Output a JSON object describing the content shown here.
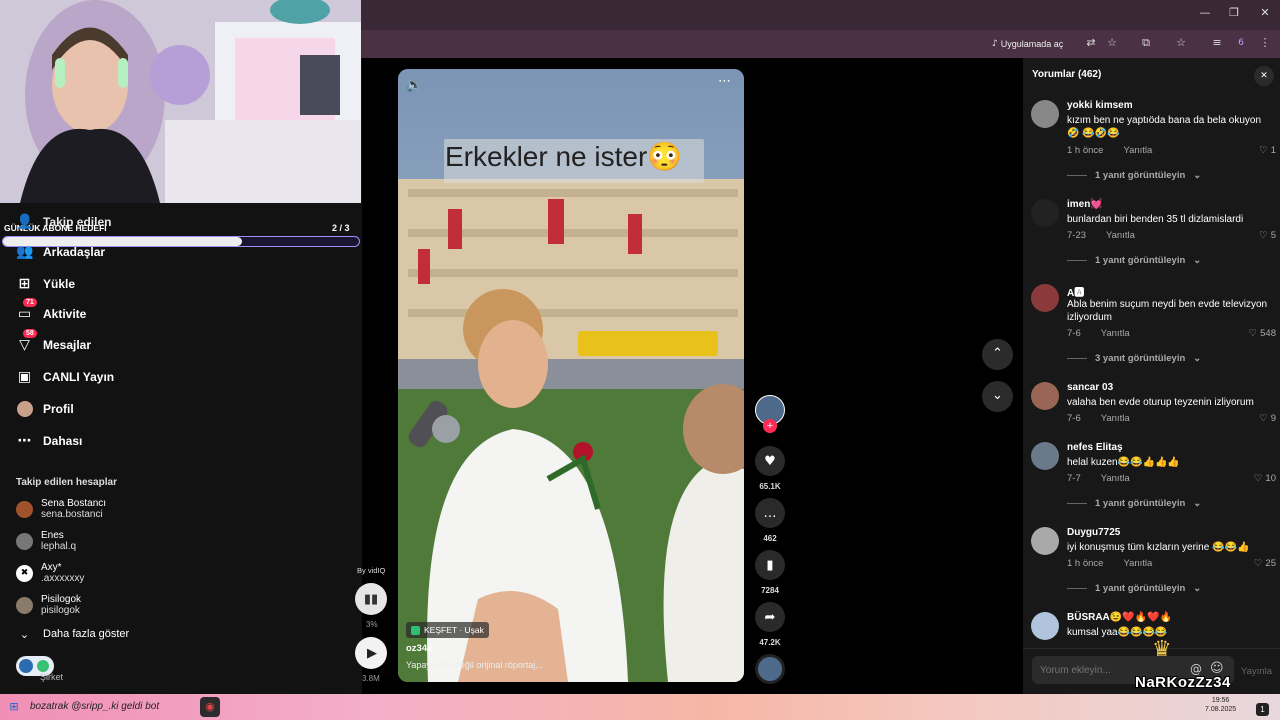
{
  "browser": {
    "window_controls": {
      "minimize": "—",
      "restore": "❐",
      "close": "✕"
    },
    "open_in_app_label": "Uygulamada aç",
    "profile_badge": "6"
  },
  "overlay": {
    "goal_label": "GÜNLÜK ABONE HEDEFİ",
    "goal_count": "2 / 3",
    "goal_progress": 0.67,
    "bottom_name": "NaRKozZz34"
  },
  "nav": {
    "following": "Takip edilen",
    "friends": "Arkadaşlar",
    "upload": "Yükle",
    "activity": "Aktivite",
    "activity_badge": "71",
    "messages": "Mesajlar",
    "messages_badge": "58",
    "live": "CANLI Yayın",
    "profile": "Profil",
    "more": "Dahası"
  },
  "following_section": {
    "title": "Takip edilen hesaplar",
    "accounts": [
      {
        "name": "Sena Bostancı",
        "handle": "sena.bostanci",
        "color": "#a0522d"
      },
      {
        "name": "Enes",
        "handle": "lephal.q",
        "color": "#777777"
      },
      {
        "name": "Axy*",
        "handle": ".axxxxxxy",
        "color": "#ffffff"
      },
      {
        "name": "Pisilogok",
        "handle": "pisilogok",
        "color": "#8a7a6a"
      }
    ],
    "show_more": "Daha fazla göster",
    "company": "Şirket"
  },
  "vidiq": {
    "by": "By vidIQ",
    "percent": "3%",
    "views": "3.8M"
  },
  "video": {
    "caption_overlay": "Erkekler ne ister😳",
    "location": "KEŞFET · Uşak",
    "author": "oz34x",
    "description": "Yapay zeka değil orijinal röportaj..."
  },
  "actions": {
    "likes": "65.1K",
    "comments": "462",
    "saves": "7284",
    "shares": "47.2K"
  },
  "comments_panel": {
    "title": "Yorumlar (462)",
    "input_placeholder": "Yorum ekleyin...",
    "post_label": "Yayınla",
    "reply_label": "Yanıtla",
    "items": [
      {
        "user": "yokki kimsem",
        "text": "kızım ben ne yaptıöda bana da bela okuyon 🤣 😂🤣😂",
        "time": "1 h önce",
        "likes": "1",
        "replies": "1 yanıt görüntüleyin",
        "color": "#888888"
      },
      {
        "user": "imen💓",
        "text": "bunlardan biri benden 35 tl dizlamislardi",
        "time": "7-23",
        "likes": "5",
        "replies": "1 yanıt görüntüleyin",
        "color": "#222222"
      },
      {
        "user": "A🅰",
        "text": "Abla benim suçum neydi ben evde televizyon izliyordum",
        "time": "7-6",
        "likes": "548",
        "replies": "3 yanıt görüntüleyin",
        "color": "#8a3a3a"
      },
      {
        "user": "sancar 03",
        "text": "valaha ben evde oturup teyzenin izliyorum",
        "time": "7-6",
        "likes": "9",
        "replies": "",
        "color": "#996655"
      },
      {
        "user": "nefes Elitaş",
        "text": "helal kuzen😂😂👍👍👍",
        "time": "7-7",
        "likes": "10",
        "replies": "1 yanıt görüntüleyin",
        "color": "#6a7a8a"
      },
      {
        "user": "Duygu7725",
        "text": "iyi konuşmuş tüm kızların yerine 😂😂👍",
        "time": "1 h önce",
        "likes": "25",
        "replies": "1 yanıt görüntüleyin",
        "color": "#a9a9a9"
      },
      {
        "user": "BÜSRAA😉❤️🔥❤️🔥",
        "text": "kumsal yaa😂😂😂😂",
        "time": "",
        "likes": "",
        "replies": "",
        "color": "#b0c4de"
      }
    ]
  },
  "taskbar": {
    "ticker": "bozatrak   @sripp_.ki geldi bot",
    "time": "19:56",
    "date": "7.08.2025",
    "notif": "1"
  }
}
